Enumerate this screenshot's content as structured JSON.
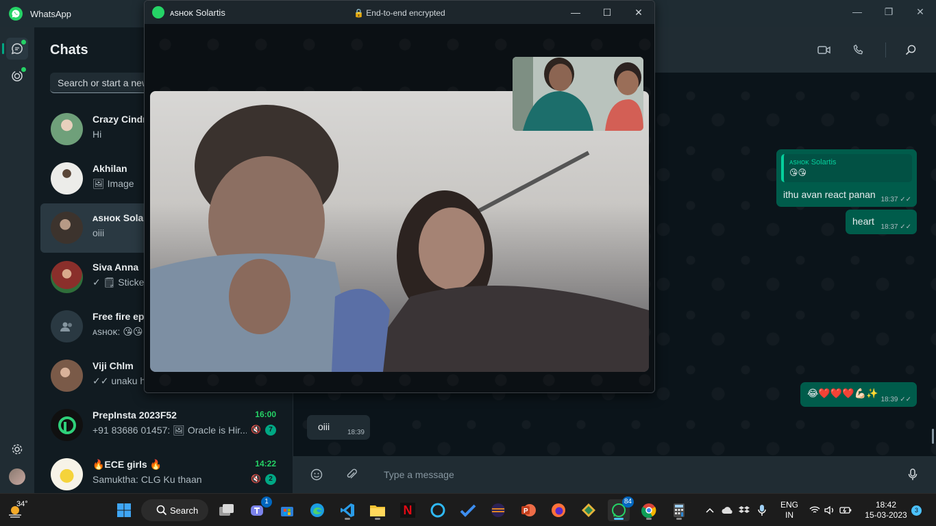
{
  "window": {
    "app_title": "WhatsApp",
    "controls": {
      "minimize": "—",
      "restore": "❐",
      "close": "✕"
    }
  },
  "chatlist": {
    "heading": "Chats",
    "search_placeholder": "Search or start a new chat",
    "items": [
      {
        "name": "Crazy Cindrella",
        "preview": "Hi",
        "avatar_color": "#6fa07a"
      },
      {
        "name": "Akhilan",
        "preview": "🖼 Image",
        "avatar_color": "#c8c8c4"
      },
      {
        "name": "ᴀsʜᴏᴋ Solartis",
        "preview": "oiii",
        "avatar_color": "#5a4a40"
      },
      {
        "name": "Siva Anna",
        "preview": "✓ 🗒 Sticker",
        "avatar_color": "#7a3a34"
      },
      {
        "name": "Free fire epopoo",
        "preview": "ᴀsʜᴏᴋ: 😘😘",
        "avatar_color": "#2a3942"
      },
      {
        "name": "Viji Chlm",
        "preview": "✓✓ unaku hts",
        "avatar_color": "#8a6e5a"
      },
      {
        "name": "PrepInsta 2023F52",
        "preview": "+91 83686 01457: 🖼 Oracle is Hir...",
        "time": "16:00",
        "badge": "7"
      },
      {
        "name": "🔥ECE girls 🔥",
        "preview": "Samuktha: CLG Ku thaan",
        "time": "14:22",
        "badge": "2"
      }
    ]
  },
  "conversation": {
    "messages": [
      {
        "quote_name": "ᴀsʜᴏᴋ Solartis",
        "quote_text": "😘😘",
        "text": "ithu avan react panan",
        "time": "18:37 ✓✓"
      },
      {
        "text": "heart",
        "time": "18:37 ✓✓"
      },
      {
        "text": "😂❤️❤️❤️💪🏻✨",
        "time": "18:39 ✓✓"
      },
      {
        "text": "oiii",
        "time": "18:39"
      }
    ],
    "composer_placeholder": "Type a message"
  },
  "call": {
    "name": "ᴀsʜᴏᴋ Solartis",
    "encryption": "🔒 End-to-end encrypted",
    "controls": {
      "minimize": "—",
      "maximize": "☐",
      "close": "✕"
    }
  },
  "taskbar": {
    "weather_temp": "34°",
    "search_label": "Search",
    "teams_badge": "1",
    "whatsapp_badge": "84",
    "lang": "ENG",
    "region": "IN",
    "time": "18:42",
    "date": "15-03-2023",
    "notif_count": "3"
  },
  "colors": {
    "accent": "#00a884",
    "outgoing_bubble": "#005c4b",
    "incoming_bubble": "#202c33",
    "background": "#111b21"
  }
}
